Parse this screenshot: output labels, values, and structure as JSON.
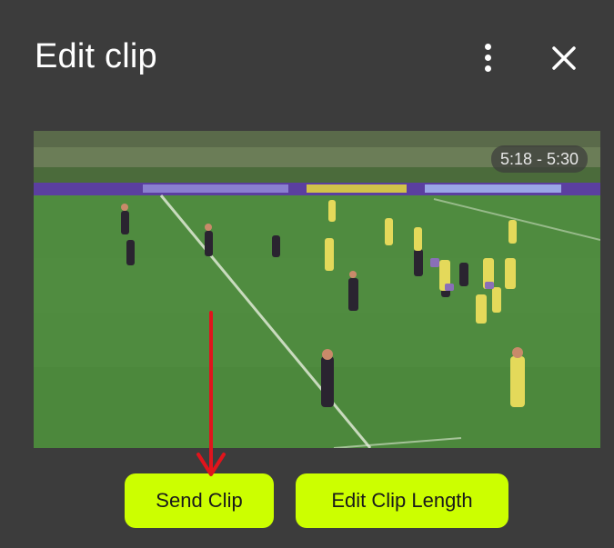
{
  "header": {
    "title": "Edit clip",
    "more_icon": "more-vertical-icon",
    "close_icon": "close-icon"
  },
  "video": {
    "time_range": "5:18 - 5:30"
  },
  "actions": {
    "send_label": "Send Clip",
    "edit_length_label": "Edit Clip Length"
  },
  "colors": {
    "background": "#3c3c3c",
    "accent": "#ccff00",
    "annotation_arrow": "#e0141c"
  }
}
